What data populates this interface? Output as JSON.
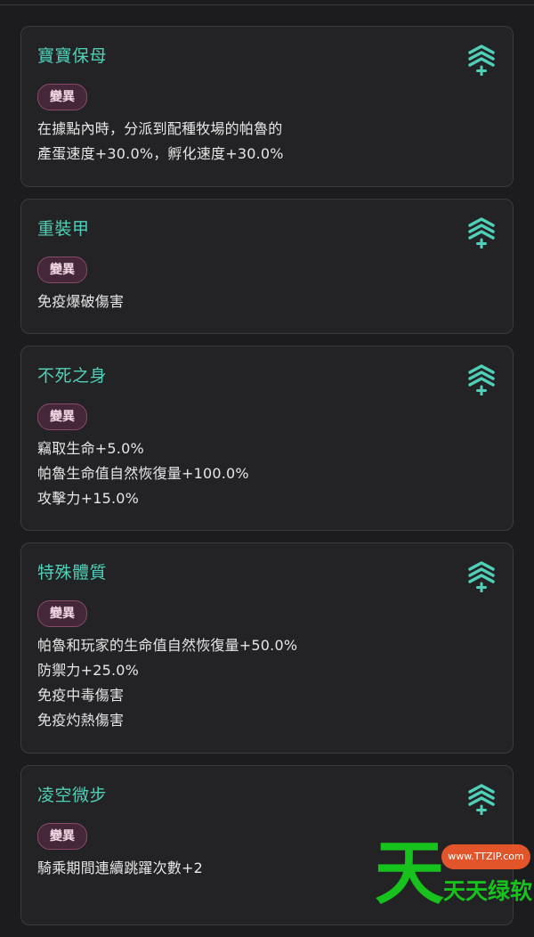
{
  "colors": {
    "background": "#1c1c1e",
    "card": "#232326",
    "title": "#4fd0b8",
    "badge_bg": "#44283a",
    "badge_border": "#8a4a6b",
    "watermark_green": "#17c21c",
    "watermark_orange": "#e2542a"
  },
  "skills": [
    {
      "title": "寶寶保母",
      "badge": "變異",
      "icon": "rank-up-chevrons-icon",
      "lines": [
        "在據點內時，分派到配種牧場的帕魯的",
        "產蛋速度+30.0%，孵化速度+30.0%"
      ]
    },
    {
      "title": "重裝甲",
      "badge": "變異",
      "icon": "rank-up-chevrons-icon",
      "lines": [
        "免疫爆破傷害"
      ]
    },
    {
      "title": "不死之身",
      "badge": "變異",
      "icon": "rank-up-chevrons-icon",
      "lines": [
        "竊取生命+5.0%",
        "帕魯生命值自然恢復量+100.0%",
        "攻擊力+15.0%"
      ]
    },
    {
      "title": "特殊體質",
      "badge": "變異",
      "icon": "rank-up-chevrons-icon",
      "lines": [
        "帕魯和玩家的生命值自然恢復量+50.0%",
        "防禦力+25.0%",
        "免疫中毒傷害",
        "免疫灼熱傷害"
      ]
    },
    {
      "title": "凌空微步",
      "badge": "變異",
      "icon": "rank-up-chevrons-icon",
      "lines": [
        "騎乘期間連續跳躍次數+2"
      ]
    }
  ],
  "watermark": {
    "glyph": "天",
    "url": "www.TTZIP.com",
    "brand": "天天绿软"
  }
}
